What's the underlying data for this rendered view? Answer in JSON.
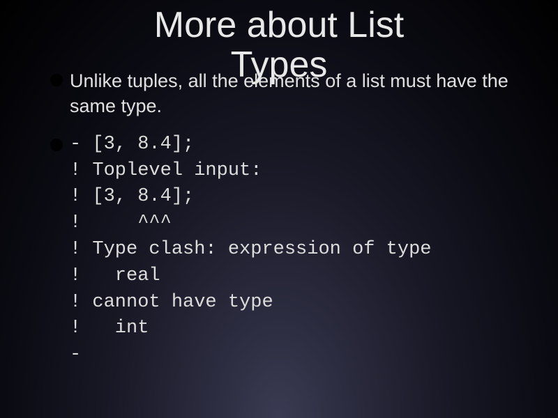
{
  "title": "More about List\nTypes",
  "bullets": [
    {
      "text": "Unlike tuples, all the elements of a list must have the same type."
    }
  ],
  "code": "- [3, 8.4];\n! Toplevel input:\n! [3, 8.4];\n!     ^^^\n! Type clash: expression of type\n!   real\n! cannot have type\n!   int\n-"
}
